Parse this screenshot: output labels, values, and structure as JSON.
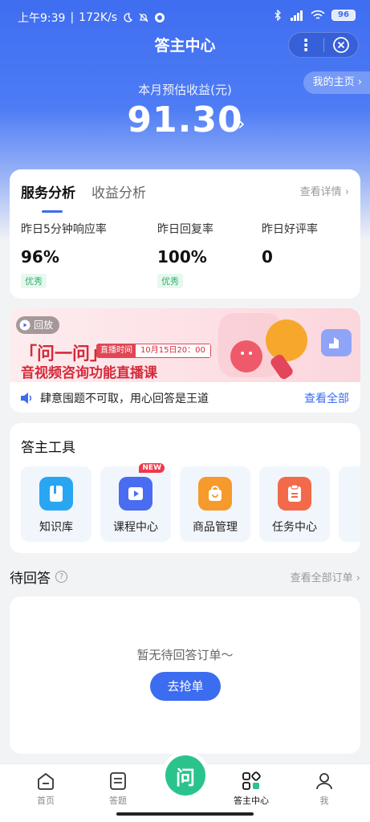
{
  "status_bar": {
    "time": "上午9:39",
    "speed": "172K/s",
    "battery": "96"
  },
  "header": {
    "title": "答主中心",
    "my_home": "我的主页"
  },
  "earnings": {
    "label": "本月预估收益(元)",
    "value": "91.30"
  },
  "service": {
    "tabs": [
      "服务分析",
      "收益分析"
    ],
    "detail_link": "查看详情",
    "metrics": [
      {
        "label": "昨日5分钟响应率",
        "value": "96%",
        "tag": "优秀"
      },
      {
        "label": "昨日回复率",
        "value": "100%",
        "tag": "优秀"
      },
      {
        "label": "昨日好评率",
        "value": "0",
        "tag": ""
      }
    ]
  },
  "banner": {
    "replay": "回放",
    "title": "「问一问」",
    "live_key": "直播时间",
    "live_time": "10月15日20：00",
    "subtitle": "音视频咨询功能直播课",
    "notice": "肆意囤题不可取，用心回答是王道",
    "view_all": "查看全部"
  },
  "tools": {
    "title": "答主工具",
    "new_badge": "NEW",
    "items": [
      {
        "label": "知识库",
        "icon": "book-icon",
        "color": "#29a6f2"
      },
      {
        "label": "课程中心",
        "icon": "video-course-icon",
        "color": "#4a6cf0"
      },
      {
        "label": "商品管理",
        "icon": "shopping-bag-icon",
        "color": "#f59a2b"
      },
      {
        "label": "任务中心",
        "icon": "clipboard-icon",
        "color": "#f26a4a"
      }
    ]
  },
  "pending": {
    "title": "待回答",
    "all_orders": "查看全部订单",
    "empty_text": "暂无待回答订单～",
    "grab_button": "去抢单"
  },
  "tabbar": {
    "items": [
      {
        "label": "首页",
        "icon": "home-icon"
      },
      {
        "label": "答题",
        "icon": "answer-icon"
      },
      {
        "label": "答主中心",
        "icon": "dashboard-icon"
      },
      {
        "label": "我",
        "icon": "profile-icon"
      }
    ],
    "center_label": "问"
  }
}
